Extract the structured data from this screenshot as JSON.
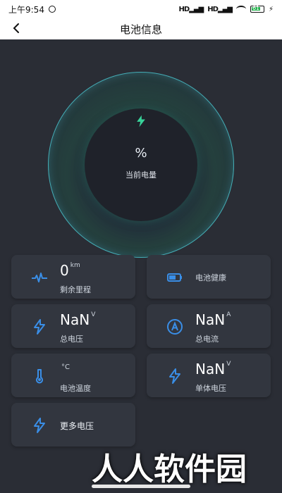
{
  "status": {
    "time": "上午9:54",
    "signal_text": "HD",
    "battery_text": "61"
  },
  "header": {
    "title": "电池信息"
  },
  "gauge": {
    "percent_display": "%",
    "label": "当前电量",
    "accent": "#38d39a",
    "ring_color": "#49bac4"
  },
  "cards": [
    {
      "value": "0",
      "unit": "km",
      "label": "剩余里程",
      "icon": "pulse-icon"
    },
    {
      "value": "",
      "unit": "",
      "label": "电池健康",
      "icon": "battery-icon"
    },
    {
      "value": "NaN",
      "unit": "V",
      "label": "总电压",
      "icon": "bolt-icon"
    },
    {
      "value": "NaN",
      "unit": "A",
      "label": "总电流",
      "icon": "ampere-icon"
    },
    {
      "value": "",
      "unit": "°C",
      "label": "电池温度",
      "icon": "thermometer-icon"
    },
    {
      "value": "NaN",
      "unit": "V",
      "label": "单体电压",
      "icon": "bolt-icon"
    },
    {
      "value": "",
      "unit": "",
      "label": "更多电压",
      "icon": "bolt-icon"
    }
  ],
  "watermark": {
    "text": "人人软件园"
  }
}
